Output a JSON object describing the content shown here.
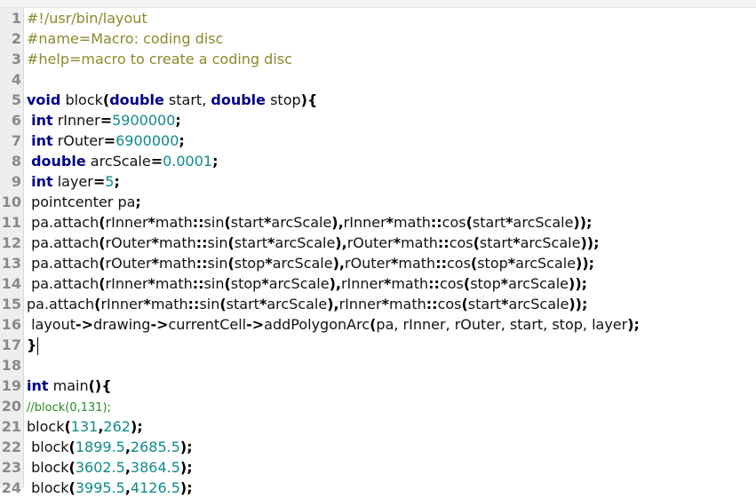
{
  "editor": {
    "lines": [
      {
        "n": "1",
        "tokens": [
          {
            "t": "#!/usr/bin/layout",
            "c": "comment"
          }
        ]
      },
      {
        "n": "2",
        "tokens": [
          {
            "t": "#name=Macro: coding disc",
            "c": "comment"
          }
        ]
      },
      {
        "n": "3",
        "tokens": [
          {
            "t": "#help=macro to create a coding disc",
            "c": "comment"
          }
        ]
      },
      {
        "n": "4",
        "tokens": []
      },
      {
        "n": "5",
        "tokens": [
          {
            "t": "void",
            "c": "kw"
          },
          {
            "t": " block",
            "c": ""
          },
          {
            "t": "(",
            "c": "op"
          },
          {
            "t": "double",
            "c": "kw"
          },
          {
            "t": " start, ",
            "c": ""
          },
          {
            "t": "double",
            "c": "kw"
          },
          {
            "t": " stop",
            "c": ""
          },
          {
            "t": "){",
            "c": "op"
          }
        ]
      },
      {
        "n": "6",
        "tokens": [
          {
            "t": " ",
            "c": ""
          },
          {
            "t": "int",
            "c": "kw"
          },
          {
            "t": " rInner",
            "c": ""
          },
          {
            "t": "=",
            "c": "op"
          },
          {
            "t": "5900000",
            "c": "num"
          },
          {
            "t": ";",
            "c": "op"
          }
        ]
      },
      {
        "n": "7",
        "tokens": [
          {
            "t": " ",
            "c": ""
          },
          {
            "t": "int",
            "c": "kw"
          },
          {
            "t": " rOuter",
            "c": ""
          },
          {
            "t": "=",
            "c": "op"
          },
          {
            "t": "6900000",
            "c": "num"
          },
          {
            "t": ";",
            "c": "op"
          }
        ]
      },
      {
        "n": "8",
        "tokens": [
          {
            "t": " ",
            "c": ""
          },
          {
            "t": "double",
            "c": "kw"
          },
          {
            "t": " arcScale",
            "c": ""
          },
          {
            "t": "=",
            "c": "op"
          },
          {
            "t": "0.0001",
            "c": "num"
          },
          {
            "t": ";",
            "c": "op"
          }
        ]
      },
      {
        "n": "9",
        "tokens": [
          {
            "t": " ",
            "c": ""
          },
          {
            "t": "int",
            "c": "kw"
          },
          {
            "t": " layer",
            "c": ""
          },
          {
            "t": "=",
            "c": "op"
          },
          {
            "t": "5",
            "c": "num"
          },
          {
            "t": ";",
            "c": "op"
          }
        ]
      },
      {
        "n": "10",
        "tokens": [
          {
            "t": " pointcenter pa",
            "c": ""
          },
          {
            "t": ";",
            "c": "op"
          }
        ]
      },
      {
        "n": "11",
        "tokens": [
          {
            "t": " pa.attach",
            "c": ""
          },
          {
            "t": "(",
            "c": "op"
          },
          {
            "t": "rInner",
            "c": ""
          },
          {
            "t": "*",
            "c": "op"
          },
          {
            "t": "math",
            "c": ""
          },
          {
            "t": "::",
            "c": "op"
          },
          {
            "t": "sin",
            "c": ""
          },
          {
            "t": "(",
            "c": "op"
          },
          {
            "t": "start",
            "c": ""
          },
          {
            "t": "*",
            "c": "op"
          },
          {
            "t": "arcScale",
            "c": ""
          },
          {
            "t": "),",
            "c": "op"
          },
          {
            "t": "rInner",
            "c": ""
          },
          {
            "t": "*",
            "c": "op"
          },
          {
            "t": "math",
            "c": ""
          },
          {
            "t": "::",
            "c": "op"
          },
          {
            "t": "cos",
            "c": ""
          },
          {
            "t": "(",
            "c": "op"
          },
          {
            "t": "start",
            "c": ""
          },
          {
            "t": "*",
            "c": "op"
          },
          {
            "t": "arcScale",
            "c": ""
          },
          {
            "t": "));",
            "c": "op"
          }
        ]
      },
      {
        "n": "12",
        "tokens": [
          {
            "t": " pa.attach",
            "c": ""
          },
          {
            "t": "(",
            "c": "op"
          },
          {
            "t": "rOuter",
            "c": ""
          },
          {
            "t": "*",
            "c": "op"
          },
          {
            "t": "math",
            "c": ""
          },
          {
            "t": "::",
            "c": "op"
          },
          {
            "t": "sin",
            "c": ""
          },
          {
            "t": "(",
            "c": "op"
          },
          {
            "t": "start",
            "c": ""
          },
          {
            "t": "*",
            "c": "op"
          },
          {
            "t": "arcScale",
            "c": ""
          },
          {
            "t": "),",
            "c": "op"
          },
          {
            "t": "rOuter",
            "c": ""
          },
          {
            "t": "*",
            "c": "op"
          },
          {
            "t": "math",
            "c": ""
          },
          {
            "t": "::",
            "c": "op"
          },
          {
            "t": "cos",
            "c": ""
          },
          {
            "t": "(",
            "c": "op"
          },
          {
            "t": "start",
            "c": ""
          },
          {
            "t": "*",
            "c": "op"
          },
          {
            "t": "arcScale",
            "c": ""
          },
          {
            "t": "));",
            "c": "op"
          }
        ]
      },
      {
        "n": "13",
        "tokens": [
          {
            "t": " pa.attach",
            "c": ""
          },
          {
            "t": "(",
            "c": "op"
          },
          {
            "t": "rOuter",
            "c": ""
          },
          {
            "t": "*",
            "c": "op"
          },
          {
            "t": "math",
            "c": ""
          },
          {
            "t": "::",
            "c": "op"
          },
          {
            "t": "sin",
            "c": ""
          },
          {
            "t": "(",
            "c": "op"
          },
          {
            "t": "stop",
            "c": ""
          },
          {
            "t": "*",
            "c": "op"
          },
          {
            "t": "arcScale",
            "c": ""
          },
          {
            "t": "),",
            "c": "op"
          },
          {
            "t": "rOuter",
            "c": ""
          },
          {
            "t": "*",
            "c": "op"
          },
          {
            "t": "math",
            "c": ""
          },
          {
            "t": "::",
            "c": "op"
          },
          {
            "t": "cos",
            "c": ""
          },
          {
            "t": "(",
            "c": "op"
          },
          {
            "t": "stop",
            "c": ""
          },
          {
            "t": "*",
            "c": "op"
          },
          {
            "t": "arcScale",
            "c": ""
          },
          {
            "t": "));",
            "c": "op"
          }
        ]
      },
      {
        "n": "14",
        "tokens": [
          {
            "t": " pa.attach",
            "c": ""
          },
          {
            "t": "(",
            "c": "op"
          },
          {
            "t": "rInner",
            "c": ""
          },
          {
            "t": "*",
            "c": "op"
          },
          {
            "t": "math",
            "c": ""
          },
          {
            "t": "::",
            "c": "op"
          },
          {
            "t": "sin",
            "c": ""
          },
          {
            "t": "(",
            "c": "op"
          },
          {
            "t": "stop",
            "c": ""
          },
          {
            "t": "*",
            "c": "op"
          },
          {
            "t": "arcScale",
            "c": ""
          },
          {
            "t": "),",
            "c": "op"
          },
          {
            "t": "rInner",
            "c": ""
          },
          {
            "t": "*",
            "c": "op"
          },
          {
            "t": "math",
            "c": ""
          },
          {
            "t": "::",
            "c": "op"
          },
          {
            "t": "cos",
            "c": ""
          },
          {
            "t": "(",
            "c": "op"
          },
          {
            "t": "stop",
            "c": ""
          },
          {
            "t": "*",
            "c": "op"
          },
          {
            "t": "arcScale",
            "c": ""
          },
          {
            "t": "));",
            "c": "op"
          }
        ]
      },
      {
        "n": "15",
        "tokens": [
          {
            "t": "pa.attach",
            "c": ""
          },
          {
            "t": "(",
            "c": "op"
          },
          {
            "t": "rInner",
            "c": ""
          },
          {
            "t": "*",
            "c": "op"
          },
          {
            "t": "math",
            "c": ""
          },
          {
            "t": "::",
            "c": "op"
          },
          {
            "t": "sin",
            "c": ""
          },
          {
            "t": "(",
            "c": "op"
          },
          {
            "t": "start",
            "c": ""
          },
          {
            "t": "*",
            "c": "op"
          },
          {
            "t": "arcScale",
            "c": ""
          },
          {
            "t": "),",
            "c": "op"
          },
          {
            "t": "rInner",
            "c": ""
          },
          {
            "t": "*",
            "c": "op"
          },
          {
            "t": "math",
            "c": ""
          },
          {
            "t": "::",
            "c": "op"
          },
          {
            "t": "cos",
            "c": ""
          },
          {
            "t": "(",
            "c": "op"
          },
          {
            "t": "start",
            "c": ""
          },
          {
            "t": "*",
            "c": "op"
          },
          {
            "t": "arcScale",
            "c": ""
          },
          {
            "t": "));",
            "c": "op"
          }
        ]
      },
      {
        "n": "16",
        "tokens": [
          {
            "t": " layout",
            "c": ""
          },
          {
            "t": "->",
            "c": "op"
          },
          {
            "t": "drawing",
            "c": ""
          },
          {
            "t": "->",
            "c": "op"
          },
          {
            "t": "currentCell",
            "c": ""
          },
          {
            "t": "->",
            "c": "op"
          },
          {
            "t": "addPolygonArc",
            "c": ""
          },
          {
            "t": "(",
            "c": "op"
          },
          {
            "t": "pa, rInner, rOuter, start, stop, layer",
            "c": ""
          },
          {
            "t": ");",
            "c": "op"
          }
        ]
      },
      {
        "n": "17",
        "tokens": [
          {
            "t": "}",
            "c": "op"
          }
        ],
        "cursor": true
      },
      {
        "n": "18",
        "tokens": []
      },
      {
        "n": "19",
        "tokens": [
          {
            "t": "int",
            "c": "kw"
          },
          {
            "t": " main",
            "c": ""
          },
          {
            "t": "(){",
            "c": "op"
          }
        ]
      },
      {
        "n": "20",
        "tokens": [
          {
            "t": "//block(0,131);",
            "c": "green"
          }
        ]
      },
      {
        "n": "21",
        "tokens": [
          {
            "t": "block",
            "c": ""
          },
          {
            "t": "(",
            "c": "op"
          },
          {
            "t": "131",
            "c": "num"
          },
          {
            "t": ",",
            "c": "op"
          },
          {
            "t": "262",
            "c": "num"
          },
          {
            "t": ");",
            "c": "op"
          }
        ]
      },
      {
        "n": "22",
        "tokens": [
          {
            "t": " block",
            "c": ""
          },
          {
            "t": "(",
            "c": "op"
          },
          {
            "t": "1899.5",
            "c": "num"
          },
          {
            "t": ",",
            "c": "op"
          },
          {
            "t": "2685.5",
            "c": "num"
          },
          {
            "t": ");",
            "c": "op"
          }
        ]
      },
      {
        "n": "23",
        "tokens": [
          {
            "t": " block",
            "c": ""
          },
          {
            "t": "(",
            "c": "op"
          },
          {
            "t": "3602.5",
            "c": "num"
          },
          {
            "t": ",",
            "c": "op"
          },
          {
            "t": "3864.5",
            "c": "num"
          },
          {
            "t": ");",
            "c": "op"
          }
        ]
      },
      {
        "n": "24",
        "tokens": [
          {
            "t": " block",
            "c": ""
          },
          {
            "t": "(",
            "c": "op"
          },
          {
            "t": "3995.5",
            "c": "num"
          },
          {
            "t": ",",
            "c": "op"
          },
          {
            "t": "4126.5",
            "c": "num"
          },
          {
            "t": ");",
            "c": "op"
          }
        ]
      }
    ]
  }
}
